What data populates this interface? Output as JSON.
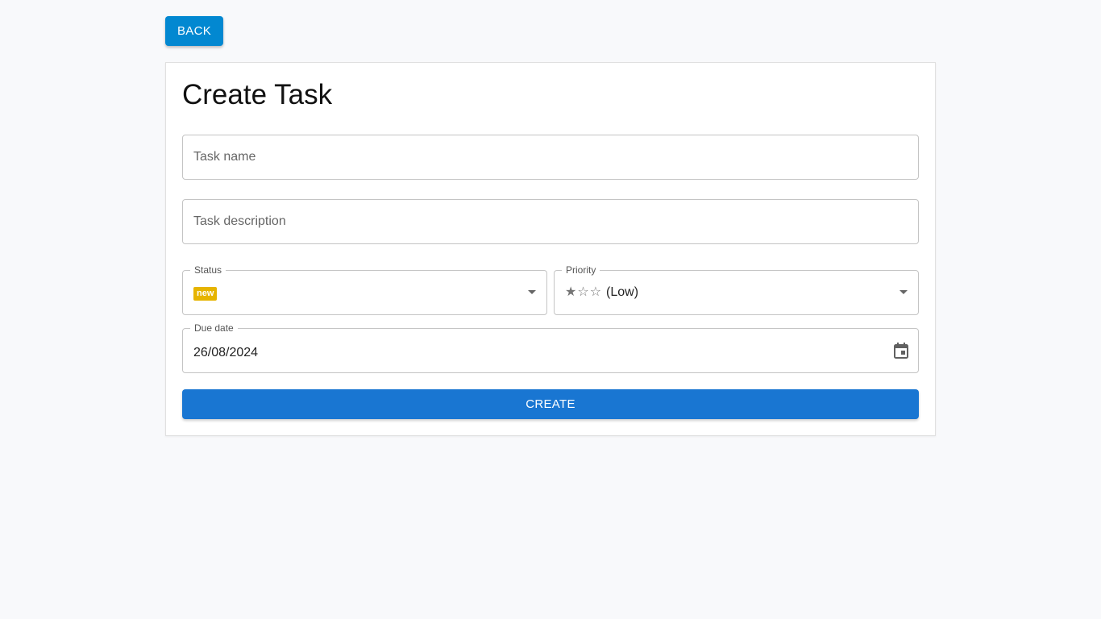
{
  "nav": {
    "back_label": "BACK"
  },
  "form": {
    "title": "Create Task",
    "task_name": {
      "placeholder": "Task name",
      "value": ""
    },
    "task_description": {
      "placeholder": "Task description",
      "value": ""
    },
    "status": {
      "label": "Status",
      "value": "new",
      "badge_color": "#e6b400"
    },
    "priority": {
      "label": "Priority",
      "value": "(Low)",
      "stars_filled": 1,
      "stars_total": 3
    },
    "due_date": {
      "label": "Due date",
      "value": "26/08/2024"
    },
    "create_label": "CREATE"
  },
  "colors": {
    "back_button": "#0288d1",
    "create_button": "#1976d2",
    "background": "#f8f9fb"
  },
  "icons": {
    "status_dropdown": "chevron-down-icon",
    "priority_dropdown": "chevron-down-icon",
    "due_date": "calendar-icon",
    "priority_star": "star-icon"
  }
}
